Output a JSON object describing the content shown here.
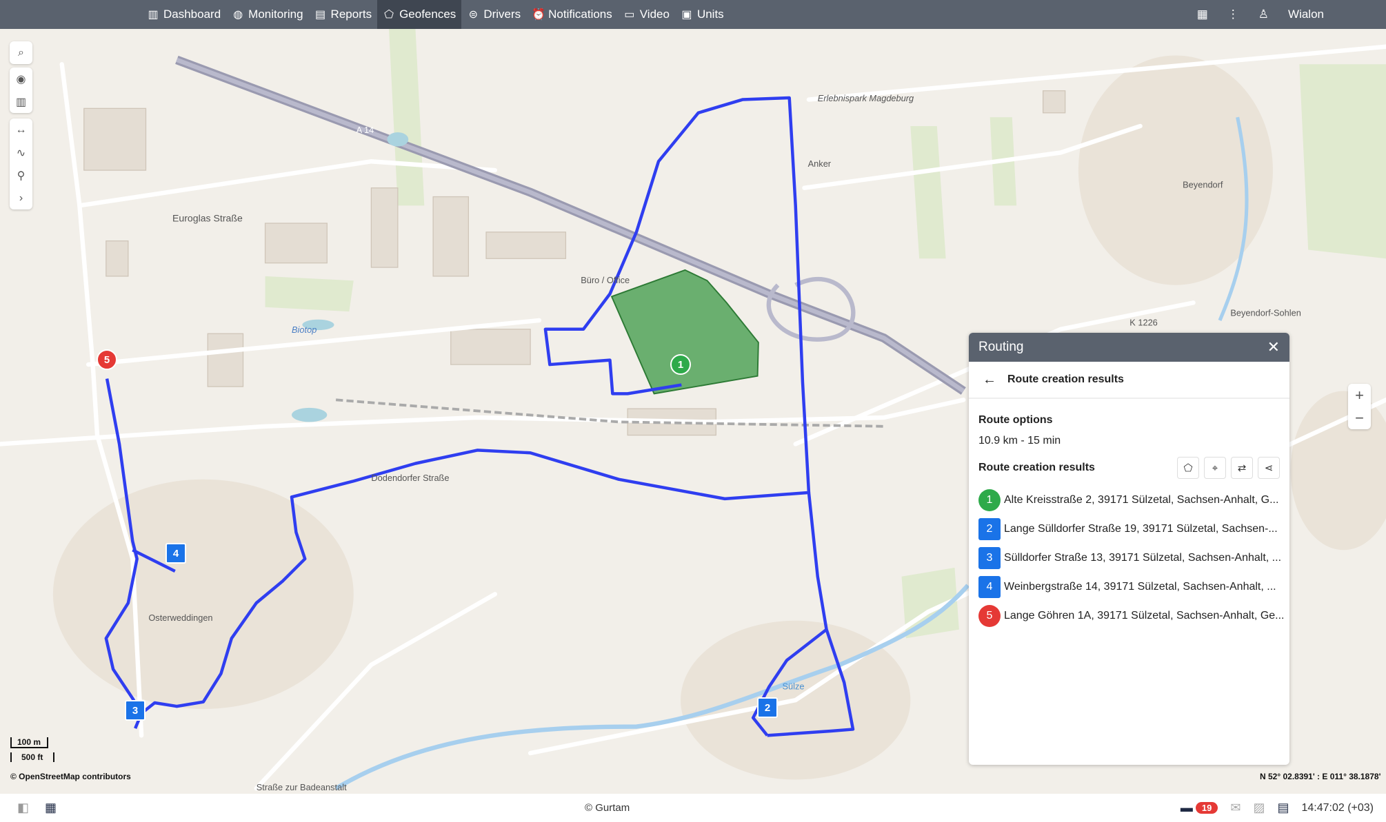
{
  "topbar": {
    "nav": [
      {
        "label": "Dashboard",
        "icon": "bar-chart-icon"
      },
      {
        "label": "Monitoring",
        "icon": "globe-icon"
      },
      {
        "label": "Reports",
        "icon": "report-icon"
      },
      {
        "label": "Geofences",
        "icon": "geofence-icon",
        "active": true
      },
      {
        "label": "Drivers",
        "icon": "steering-wheel-icon"
      },
      {
        "label": "Notifications",
        "icon": "alarm-clock-icon"
      },
      {
        "label": "Video",
        "icon": "video-icon"
      },
      {
        "label": "Units",
        "icon": "bus-icon"
      }
    ],
    "user": "Wialon"
  },
  "map": {
    "attribution": "© OpenStreetMap contributors",
    "scale_metric": "100 m",
    "scale_imperial": "500 ft",
    "coordinates": "N 52° 02.8391' : E 011° 38.1878'",
    "geofence_color": "#3c9a46",
    "route_color": "#2f3ef0",
    "labels": [
      "Erlebnispark Magdeburg",
      "Euroglas Straße",
      "Biotop",
      "Osterweddingen",
      "Beyendorf",
      "Beyendorf-Sohlen",
      "Anker",
      "K 1226",
      "A 14",
      "Sülze",
      "Straße zur Badeanstalt",
      "Dodendorfer Straße",
      "Büro / Office"
    ],
    "markers": [
      {
        "label": "1",
        "color": "#2eaa4a",
        "shape": "round"
      },
      {
        "label": "2",
        "color": "#1a73e8",
        "shape": "square"
      },
      {
        "label": "3",
        "color": "#1a73e8",
        "shape": "square"
      },
      {
        "label": "4",
        "color": "#1a73e8",
        "shape": "square"
      },
      {
        "label": "5",
        "color": "#e53935",
        "shape": "round"
      }
    ]
  },
  "routing": {
    "title": "Routing",
    "subtitle": "Route creation results",
    "options_heading": "Route options",
    "options_value": "10.9 km - 15 min",
    "results_heading": "Route creation results",
    "stops": [
      {
        "n": "1",
        "address": "Alte Kreisstraße 2, 39171 Sülzetal, Sachsen-Anhalt, G...",
        "color": "#2eaa4a",
        "shape": "round"
      },
      {
        "n": "2",
        "address": "Lange Sülldorfer Straße 19, 39171 Sülzetal, Sachsen-...",
        "color": "#1a73e8",
        "shape": "square"
      },
      {
        "n": "3",
        "address": "Sülldorfer Straße 13, 39171 Sülzetal, Sachsen-Anhalt, ...",
        "color": "#1a73e8",
        "shape": "square"
      },
      {
        "n": "4",
        "address": "Weinbergstraße 14, 39171 Sülzetal, Sachsen-Anhalt, ...",
        "color": "#1a73e8",
        "shape": "square"
      },
      {
        "n": "5",
        "address": "Lange Göhren 1A, 39171 Sülzetal, Sachsen-Anhalt, Ge...",
        "color": "#e53935",
        "shape": "round"
      }
    ]
  },
  "bottombar": {
    "copyright": "© Gurtam",
    "notifications_count": "19",
    "time": "14:47:02 (+03)"
  }
}
